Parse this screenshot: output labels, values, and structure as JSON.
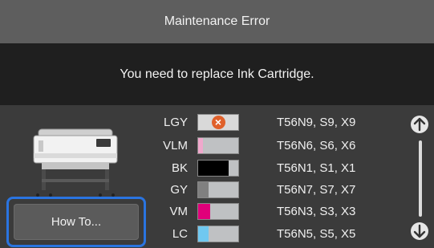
{
  "header": {
    "title": "Maintenance Error"
  },
  "message": {
    "text": "You need to replace Ink Cartridge."
  },
  "actions": {
    "how_to_label": "How To..."
  },
  "colors": {
    "title_bg": "#5e5e5e",
    "message_bg": "#1f1f1f",
    "panel_bg": "#3b3b3b",
    "focus_border": "#2a74e0",
    "error_icon": "#e0602a"
  },
  "inks": [
    {
      "code": "LGY",
      "level": null,
      "status": "replace",
      "icon": "error-x-icon",
      "part": "T56N9, S9, X9"
    },
    {
      "code": "VLM",
      "level": 0.12,
      "color": "#f0a8cc",
      "part": "T56N6, S6, X6"
    },
    {
      "code": "BK",
      "level": 0.75,
      "color": "#000000",
      "part": "T56N1, S1, X1"
    },
    {
      "code": "GY",
      "level": 0.25,
      "color": "#808080",
      "part": "T56N7, S7, X7"
    },
    {
      "code": "VM",
      "level": 0.3,
      "color": "#e0007a",
      "part": "T56N3, S3, X3"
    },
    {
      "code": "LC",
      "level": 0.25,
      "color": "#70c8f0",
      "part": "T56N5, S5, X5"
    }
  ],
  "scroll": {
    "up_icon": "arrow-up-circle-icon",
    "down_icon": "arrow-down-circle-icon"
  }
}
